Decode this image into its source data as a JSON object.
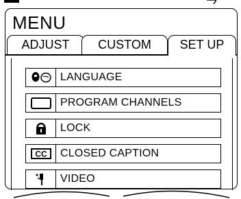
{
  "menu": {
    "title": "MENU"
  },
  "tabs": [
    {
      "label": "ADJUST",
      "active": false
    },
    {
      "label": "CUSTOM",
      "active": false
    },
    {
      "label": "SET UP",
      "active": true
    }
  ],
  "items": [
    {
      "label": "LANGUAGE",
      "icon": "speech-language-icon"
    },
    {
      "label": "PROGRAM CHANNELS",
      "icon": "tv-screen-icon"
    },
    {
      "label": "LOCK",
      "icon": "lock-icon"
    },
    {
      "label": "CLOSED CAPTION",
      "icon": "cc-icon"
    },
    {
      "label": "VIDEO",
      "icon": "video-plug-icon"
    }
  ]
}
